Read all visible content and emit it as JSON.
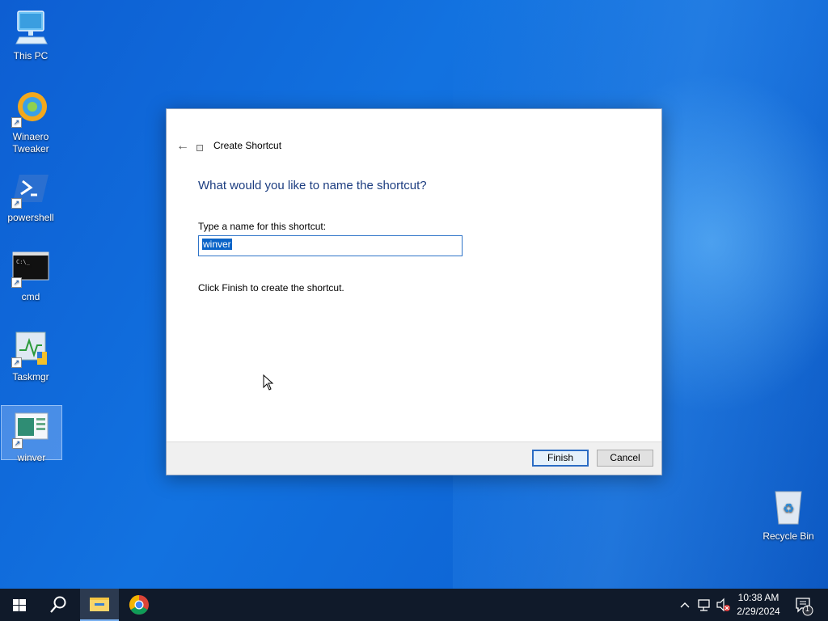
{
  "desktop": {
    "icons": [
      {
        "label": "This PC"
      },
      {
        "label": "Winaero Tweaker"
      },
      {
        "label": "powershell"
      },
      {
        "label": "cmd"
      },
      {
        "label": "Taskmgr"
      },
      {
        "label": "winver"
      },
      {
        "label": "Recycle Bin"
      }
    ]
  },
  "dialog": {
    "title": "Create Shortcut",
    "heading": "What would you like to name the shortcut?",
    "field_label": "Type a name for this shortcut:",
    "field_value": "winver",
    "info": "Click Finish to create the shortcut.",
    "finish_label": "Finish",
    "cancel_label": "Cancel"
  },
  "taskbar": {
    "time": "10:38 AM",
    "date": "2/29/2024",
    "notification_count": "1",
    "items": [
      "start-icon",
      "search-icon",
      "file-explorer-icon",
      "chrome-icon"
    ]
  },
  "colors": {
    "accent": "#2b6cc4",
    "heading": "#1c3d80",
    "taskbar": "#101a2a"
  }
}
